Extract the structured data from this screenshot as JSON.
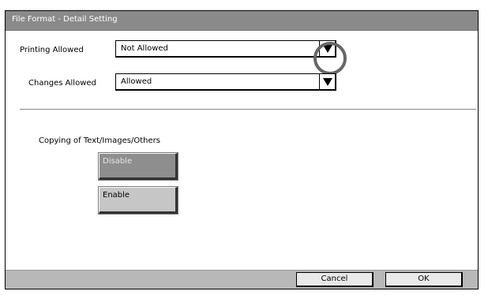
{
  "window": {
    "title": "File Format - Detail Setting"
  },
  "printing": {
    "label": "Printing Allowed",
    "value": "Not Allowed",
    "dropdown_icon": "chevron-down-icon"
  },
  "changes": {
    "label": "Changes Allowed",
    "value": "Allowed",
    "dropdown_icon": "chevron-down-icon"
  },
  "copying": {
    "label": "Copying of Text/Images/Others",
    "disable_label": "Disable",
    "enable_label": "Enable"
  },
  "footer": {
    "cancel_label": "Cancel",
    "ok_label": "OK"
  },
  "colors": {
    "titlebar": "#8a8a8a",
    "footer": "#b8b8b8",
    "selected_button": "#8e8e8e",
    "button": "#c6c6c6"
  }
}
